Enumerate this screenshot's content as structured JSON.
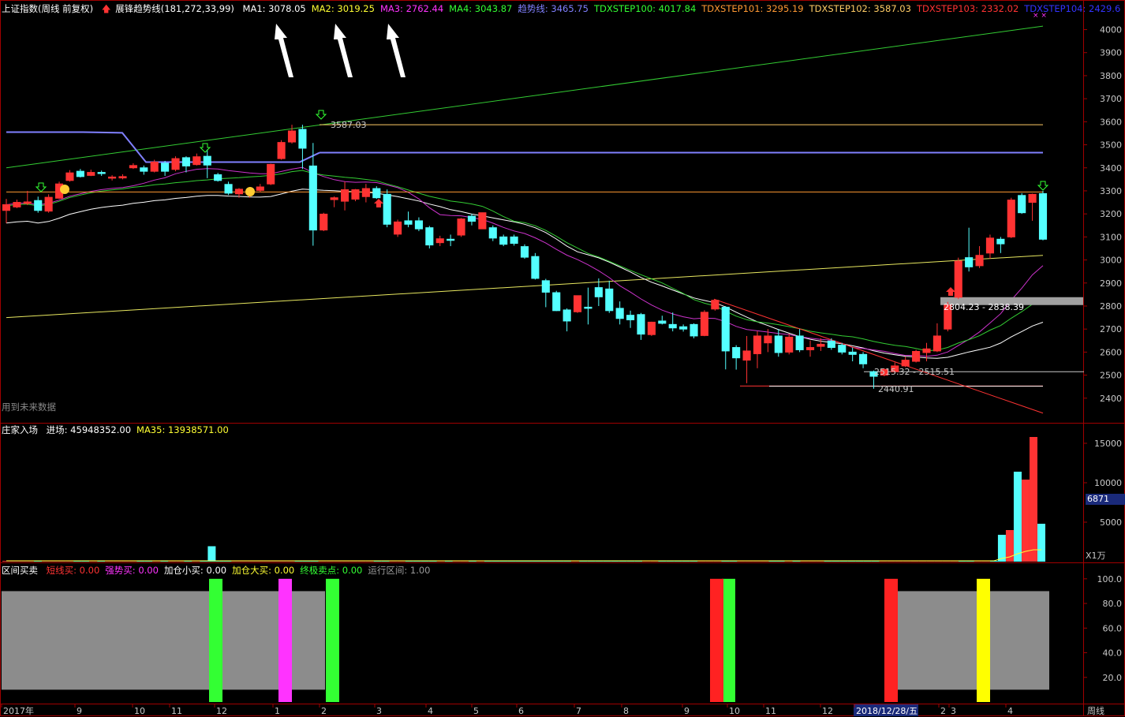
{
  "header_main": {
    "title": "上证指数(周线 前复权)",
    "indicator": "展锋趋势线(181,272,33,99)",
    "items": [
      {
        "label": "MA1:",
        "value": "3078.05",
        "color": "#ffffff"
      },
      {
        "label": "MA2:",
        "value": "3019.25",
        "color": "#ffff33"
      },
      {
        "label": "MA3:",
        "value": "2762.44",
        "color": "#ff33ff"
      },
      {
        "label": "MA4:",
        "value": "3043.87",
        "color": "#33ff33"
      },
      {
        "label": "趋势线:",
        "value": "3465.75",
        "color": "#8080ff"
      },
      {
        "label": "TDXSTEP100:",
        "value": "4017.84",
        "color": "#33ff33"
      },
      {
        "label": "TDXSTEP101:",
        "value": "3295.19",
        "color": "#ff9933"
      },
      {
        "label": "TDXSTEP102:",
        "value": "3587.03",
        "color": "#ffcc66"
      },
      {
        "label": "TDXSTEP103:",
        "value": "2332.02",
        "color": "#ff3333"
      },
      {
        "label": "TDXSTEP104:",
        "value": "2429.6",
        "color": "#3333ff"
      }
    ],
    "future_note": "用到未来数据"
  },
  "header_vol": {
    "title": "庄家入场",
    "items": [
      {
        "label": "进场:",
        "value": "45948352.00",
        "color": "#ffffff"
      },
      {
        "label": "MA35:",
        "value": "13938571.00",
        "color": "#ffff33"
      }
    ],
    "unit": "X1万",
    "current_value": "6871"
  },
  "header_signal": {
    "title": "区间买卖",
    "items": [
      {
        "label": "短线买:",
        "value": "0.00",
        "color": "#ff3333"
      },
      {
        "label": "强势买:",
        "value": "0.00",
        "color": "#ff33ff"
      },
      {
        "label": "加仓小买:",
        "value": "0.00",
        "color": "#ffffff"
      },
      {
        "label": "加仓大买:",
        "value": "0.00",
        "color": "#ffff33"
      },
      {
        "label": "终极卖点:",
        "value": "0.00",
        "color": "#33ff33"
      },
      {
        "label": "运行区间:",
        "value": "1.00",
        "color": "#999999"
      }
    ]
  },
  "annotations": {
    "high_label": "3587.03",
    "gap_label": "2804.23 - 2838.39",
    "low_gap_label": "2515.32 - 2515.51",
    "low_label": "2440.91"
  },
  "x_axis": {
    "labels": [
      "2017年",
      "9",
      "10",
      "11",
      "12",
      "1",
      "2",
      "3",
      "4",
      "5",
      "6",
      "7",
      "8",
      "9",
      "10",
      "11",
      "12",
      "2018/12/28/五",
      "2",
      "3",
      "4"
    ],
    "period": "周线"
  },
  "chart_data": [
    {
      "type": "candlestick",
      "title": "上证指数(周线 前复权)",
      "ylim": [
        2300,
        4060
      ],
      "yticks": [
        2400,
        2500,
        2600,
        2700,
        2800,
        2900,
        3000,
        3100,
        3200,
        3300,
        3400,
        3500,
        3600,
        3700,
        3800,
        3900,
        4000
      ],
      "candles": [
        {
          "o": 3215,
          "c": 3240,
          "h": 3265,
          "l": 3160
        },
        {
          "o": 3230,
          "c": 3250,
          "h": 3262,
          "l": 3225
        },
        {
          "o": 3245,
          "c": 3252,
          "h": 3300,
          "l": 3238
        },
        {
          "o": 3258,
          "c": 3215,
          "h": 3275,
          "l": 3205
        },
        {
          "o": 3212,
          "c": 3272,
          "h": 3285,
          "l": 3205
        },
        {
          "o": 3268,
          "c": 3330,
          "h": 3340,
          "l": 3265
        },
        {
          "o": 3345,
          "c": 3378,
          "h": 3390,
          "l": 3340
        },
        {
          "o": 3385,
          "c": 3362,
          "h": 3395,
          "l": 3358
        },
        {
          "o": 3367,
          "c": 3380,
          "h": 3392,
          "l": 3364
        },
        {
          "o": 3380,
          "c": 3375,
          "h": 3388,
          "l": 3365
        },
        {
          "o": 3355,
          "c": 3360,
          "h": 3368,
          "l": 3345
        },
        {
          "o": 3356,
          "c": 3362,
          "h": 3372,
          "l": 3350
        },
        {
          "o": 3400,
          "c": 3410,
          "h": 3420,
          "l": 3395
        },
        {
          "o": 3400,
          "c": 3385,
          "h": 3410,
          "l": 3370
        },
        {
          "o": 3385,
          "c": 3425,
          "h": 3435,
          "l": 3380
        },
        {
          "o": 3420,
          "c": 3385,
          "h": 3430,
          "l": 3365
        },
        {
          "o": 3393,
          "c": 3440,
          "h": 3450,
          "l": 3385
        },
        {
          "o": 3444,
          "c": 3408,
          "h": 3450,
          "l": 3380
        },
        {
          "o": 3414,
          "c": 3448,
          "h": 3462,
          "l": 3410
        },
        {
          "o": 3450,
          "c": 3412,
          "h": 3480,
          "l": 3355
        },
        {
          "o": 3370,
          "c": 3345,
          "h": 3378,
          "l": 3340
        },
        {
          "o": 3328,
          "c": 3290,
          "h": 3340,
          "l": 3282
        },
        {
          "o": 3287,
          "c": 3307,
          "h": 3312,
          "l": 3270
        },
        {
          "o": 3290,
          "c": 3290,
          "h": 3295,
          "l": 3270
        },
        {
          "o": 3302,
          "c": 3317,
          "h": 3330,
          "l": 3295
        },
        {
          "o": 3330,
          "c": 3415,
          "h": 3418,
          "l": 3325
        },
        {
          "o": 3440,
          "c": 3510,
          "h": 3520,
          "l": 3435
        },
        {
          "o": 3512,
          "c": 3560,
          "h": 3587,
          "l": 3505
        },
        {
          "o": 3567,
          "c": 3485,
          "h": 3587,
          "l": 3395
        },
        {
          "o": 3408,
          "c": 3130,
          "h": 3508,
          "l": 3062
        },
        {
          "o": 3130,
          "c": 3199,
          "h": 3205,
          "l": 3125
        },
        {
          "o": 3262,
          "c": 3270,
          "h": 3276,
          "l": 3229
        },
        {
          "o": 3255,
          "c": 3305,
          "h": 3340,
          "l": 3215
        },
        {
          "o": 3264,
          "c": 3305,
          "h": 3308,
          "l": 3255
        },
        {
          "o": 3275,
          "c": 3310,
          "h": 3330,
          "l": 3250
        },
        {
          "o": 3310,
          "c": 3270,
          "h": 3320,
          "l": 3265
        },
        {
          "o": 3285,
          "c": 3155,
          "h": 3306,
          "l": 3142
        },
        {
          "o": 3112,
          "c": 3165,
          "h": 3175,
          "l": 3100
        },
        {
          "o": 3170,
          "c": 3155,
          "h": 3210,
          "l": 3142
        },
        {
          "o": 3170,
          "c": 3135,
          "h": 3185,
          "l": 3125
        },
        {
          "o": 3140,
          "c": 3065,
          "h": 3148,
          "l": 3050
        },
        {
          "o": 3075,
          "c": 3092,
          "h": 3105,
          "l": 3060
        },
        {
          "o": 3090,
          "c": 3085,
          "h": 3110,
          "l": 3060
        },
        {
          "o": 3108,
          "c": 3178,
          "h": 3182,
          "l": 3100
        },
        {
          "o": 3190,
          "c": 3168,
          "h": 3200,
          "l": 3150
        },
        {
          "o": 3135,
          "c": 3205,
          "h": 3206,
          "l": 3160
        },
        {
          "o": 3140,
          "c": 3095,
          "h": 3150,
          "l": 3082
        },
        {
          "o": 3100,
          "c": 3068,
          "h": 3110,
          "l": 3060
        },
        {
          "o": 3100,
          "c": 3072,
          "h": 3110,
          "l": 3062
        },
        {
          "o": 3058,
          "c": 3012,
          "h": 3068,
          "l": 3005
        },
        {
          "o": 3015,
          "c": 2920,
          "h": 3030,
          "l": 2915
        },
        {
          "o": 2910,
          "c": 2860,
          "h": 2918,
          "l": 2795
        },
        {
          "o": 2858,
          "c": 2780,
          "h": 2866,
          "l": 2778
        },
        {
          "o": 2783,
          "c": 2735,
          "h": 2790,
          "l": 2690
        },
        {
          "o": 2775,
          "c": 2845,
          "h": 2846,
          "l": 2770
        },
        {
          "o": 2795,
          "c": 2790,
          "h": 2880,
          "l": 2720
        },
        {
          "o": 2880,
          "c": 2840,
          "h": 2920,
          "l": 2800
        },
        {
          "o": 2874,
          "c": 2780,
          "h": 2910,
          "l": 2770
        },
        {
          "o": 2790,
          "c": 2746,
          "h": 2820,
          "l": 2720
        },
        {
          "o": 2760,
          "c": 2740,
          "h": 2780,
          "l": 2705
        },
        {
          "o": 2763,
          "c": 2678,
          "h": 2770,
          "l": 2653
        },
        {
          "o": 2676,
          "c": 2730,
          "h": 2732,
          "l": 2670
        },
        {
          "o": 2735,
          "c": 2725,
          "h": 2758,
          "l": 2720
        },
        {
          "o": 2720,
          "c": 2705,
          "h": 2772,
          "l": 2690
        },
        {
          "o": 2710,
          "c": 2700,
          "h": 2720,
          "l": 2689
        },
        {
          "o": 2720,
          "c": 2670,
          "h": 2725,
          "l": 2660
        },
        {
          "o": 2672,
          "c": 2773,
          "h": 2782,
          "l": 2669
        },
        {
          "o": 2787,
          "c": 2825,
          "h": 2828,
          "l": 2780
        },
        {
          "o": 2795,
          "c": 2605,
          "h": 2800,
          "l": 2525
        },
        {
          "o": 2620,
          "c": 2575,
          "h": 2630,
          "l": 2524
        },
        {
          "o": 2565,
          "c": 2605,
          "h": 2670,
          "l": 2465
        },
        {
          "o": 2593,
          "c": 2670,
          "h": 2690,
          "l": 2530
        },
        {
          "o": 2640,
          "c": 2670,
          "h": 2700,
          "l": 2600
        },
        {
          "o": 2670,
          "c": 2598,
          "h": 2700,
          "l": 2580
        },
        {
          "o": 2600,
          "c": 2665,
          "h": 2680,
          "l": 2590
        },
        {
          "o": 2670,
          "c": 2610,
          "h": 2700,
          "l": 2600
        },
        {
          "o": 2610,
          "c": 2620,
          "h": 2650,
          "l": 2580
        },
        {
          "o": 2625,
          "c": 2634,
          "h": 2660,
          "l": 2605
        },
        {
          "o": 2648,
          "c": 2620,
          "h": 2660,
          "l": 2610
        },
        {
          "o": 2630,
          "c": 2600,
          "h": 2640,
          "l": 2590
        },
        {
          "o": 2600,
          "c": 2590,
          "h": 2620,
          "l": 2560
        },
        {
          "o": 2590,
          "c": 2549,
          "h": 2600,
          "l": 2530
        },
        {
          "o": 2515,
          "c": 2495,
          "h": 2520,
          "l": 2441
        },
        {
          "o": 2500,
          "c": 2525,
          "h": 2530,
          "l": 2495
        },
        {
          "o": 2515,
          "c": 2540,
          "h": 2555,
          "l": 2510
        },
        {
          "o": 2540,
          "c": 2565,
          "h": 2580,
          "l": 2535
        },
        {
          "o": 2560,
          "c": 2603,
          "h": 2610,
          "l": 2555
        },
        {
          "o": 2598,
          "c": 2614,
          "h": 2640,
          "l": 2560
        },
        {
          "o": 2605,
          "c": 2670,
          "h": 2725,
          "l": 2600
        },
        {
          "o": 2700,
          "c": 2804,
          "h": 2818,
          "l": 2690
        },
        {
          "o": 2838,
          "c": 2995,
          "h": 3010,
          "l": 2830
        },
        {
          "o": 3010,
          "c": 2970,
          "h": 3140,
          "l": 2950
        },
        {
          "o": 2975,
          "c": 3020,
          "h": 3060,
          "l": 2965
        },
        {
          "o": 3030,
          "c": 3095,
          "h": 3110,
          "l": 3005
        },
        {
          "o": 3090,
          "c": 3070,
          "h": 3100,
          "l": 3030
        },
        {
          "o": 3100,
          "c": 3260,
          "h": 3270,
          "l": 3095
        },
        {
          "o": 3280,
          "c": 3205,
          "h": 3290,
          "l": 3200
        },
        {
          "o": 3250,
          "c": 3285,
          "h": 3288,
          "l": 3170
        },
        {
          "o": 3288,
          "c": 3090,
          "h": 3300,
          "l": 3085
        }
      ]
    },
    {
      "type": "bar",
      "title": "庄家入场",
      "ylim": [
        0,
        16000
      ],
      "yticks": [
        5000,
        10000,
        15000
      ],
      "series": [
        {
          "name": "进场",
          "values": [
            0,
            0,
            0,
            0,
            0,
            0,
            0,
            0,
            0,
            0,
            0,
            0,
            0,
            0,
            0,
            0,
            0,
            0,
            0,
            0,
            0,
            0,
            0,
            0,
            0,
            0,
            1950,
            0,
            0,
            0,
            0,
            0,
            0,
            0,
            0,
            0,
            0,
            0,
            0,
            0,
            0,
            0,
            0,
            0,
            0,
            0,
            0,
            0,
            0,
            0,
            0,
            0,
            0,
            0,
            0,
            0,
            0,
            0,
            0,
            0,
            0,
            0,
            0,
            0,
            0,
            0,
            0,
            0,
            0,
            0,
            0,
            0,
            0,
            0,
            0,
            0,
            0,
            0,
            0,
            0,
            0,
            0,
            0,
            0,
            0,
            0,
            0,
            0,
            0,
            0,
            0,
            0,
            0,
            0,
            0,
            0,
            0,
            0,
            0,
            0,
            0,
            0,
            0,
            0,
            0,
            0,
            0,
            0,
            0,
            0,
            0,
            0,
            0,
            0,
            0,
            0,
            0,
            0,
            0,
            0,
            0,
            0,
            0,
            0,
            0,
            0,
            3400,
            4000,
            11400,
            10400,
            15800,
            4800
          ]
        },
        {
          "name": "MA35",
          "values": [
            0,
            0,
            0,
            0,
            0,
            0,
            0,
            0,
            0,
            0,
            0,
            0,
            0,
            0,
            0,
            0,
            0,
            0,
            0,
            0,
            0,
            0,
            0,
            0,
            0,
            0,
            0,
            0,
            0,
            0,
            0,
            0,
            0,
            0,
            0,
            0,
            0,
            0,
            0,
            0,
            0,
            0,
            0,
            0,
            0,
            0,
            0,
            0,
            0,
            0,
            0,
            0,
            0,
            0,
            0,
            0,
            0,
            0,
            0,
            0,
            0,
            0,
            0,
            0,
            0,
            0,
            0,
            0,
            0,
            0,
            0,
            0,
            0,
            0,
            0,
            0,
            0,
            0,
            0,
            0,
            0,
            0,
            0,
            0,
            0,
            0,
            0,
            0,
            0,
            0,
            0,
            0,
            0,
            0,
            0,
            0,
            0,
            0,
            0,
            0,
            0,
            0,
            0,
            0,
            0,
            0,
            0,
            0,
            0,
            0,
            0,
            0,
            0,
            0,
            0,
            0,
            0,
            0,
            0,
            0,
            0,
            0,
            0,
            0,
            0,
            0,
            300,
            500,
            900,
            1200,
            1400,
            1400
          ]
        }
      ]
    },
    {
      "type": "bar",
      "title": "区间买卖",
      "ylim": [
        0,
        105
      ],
      "yticks": [
        20,
        40,
        60,
        80,
        100
      ],
      "series": [
        {
          "name": "运行区间",
          "values": [
            90
          ]
        },
        {
          "name": "终极卖点",
          "values": [
            100,
            100,
            100
          ]
        },
        {
          "name": "强势买",
          "values": [
            100
          ]
        },
        {
          "name": "短线买",
          "values": [
            100,
            100
          ]
        },
        {
          "name": "加仓大买",
          "values": [
            100
          ]
        }
      ]
    }
  ]
}
